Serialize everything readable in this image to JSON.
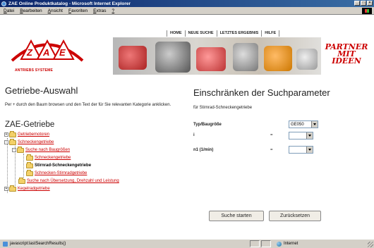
{
  "window": {
    "title": "ZAE Online Produktkatalog - Microsoft Internet Explorer",
    "controls": [
      "_",
      "□",
      "×"
    ]
  },
  "menu": [
    {
      "first": "D",
      "rest": "atei"
    },
    {
      "first": "B",
      "rest": "earbeiten"
    },
    {
      "first": "A",
      "rest": "nsicht"
    },
    {
      "first": "F",
      "rest": "avoriten"
    },
    {
      "first": "E",
      "rest": "xtras"
    },
    {
      "first": "?",
      "rest": ""
    }
  ],
  "header": {
    "logo_text": "ZAE",
    "logo_caption": "ANTRIEBS SYSTEME",
    "nav": [
      "HOME",
      "NEUE SUCHE",
      "LETZTES ERGEBNIS",
      "HILFE"
    ],
    "motto": [
      "PARTNER",
      "MIT",
      "IDEEN"
    ]
  },
  "left": {
    "title": "Getriebe-Auswahl",
    "intro": "Per + durch den Baum browsen und den Text der für Sie relevanten Kategorie anklicken.",
    "tree_title": "ZAE-Getriebe",
    "tree": [
      {
        "label": "Getriebemotoren",
        "kind": "link"
      },
      {
        "label": "Schneckengetriebe",
        "kind": "link"
      },
      {
        "label": "Suche nach Baugrößen",
        "kind": "link"
      },
      {
        "label": "Schneckengetriebe",
        "kind": "link"
      },
      {
        "label": "Stirnrad-Schneckengetriebe",
        "kind": "active"
      },
      {
        "label": "Schnecken-Stirnradgetriebe",
        "kind": "link"
      },
      {
        "label": "Suche nach Übersetzung, Drehzahl und Leistung",
        "kind": "link"
      },
      {
        "label": "Kegelradgetriebe",
        "kind": "link"
      }
    ]
  },
  "right": {
    "title": "Einschränken der Suchparameter",
    "subtitle": "für Stirnrad-Schneckengetriebe",
    "params": [
      {
        "label": "Typ/Baugröße",
        "eq": "",
        "value": "GE050"
      },
      {
        "label": "i",
        "eq": "=",
        "value": ""
      },
      {
        "label": "n1 (1/min)",
        "eq": "=",
        "value": ""
      }
    ],
    "buttons": {
      "search": "Suche starten",
      "reset": "Zurücksetzen"
    }
  },
  "status": {
    "text": "javascript:lastSearchResults()",
    "zone": "Internet"
  },
  "colors": {
    "link": "#cc0000",
    "titlebar": "#0a246a",
    "folder": "#f3d068"
  }
}
